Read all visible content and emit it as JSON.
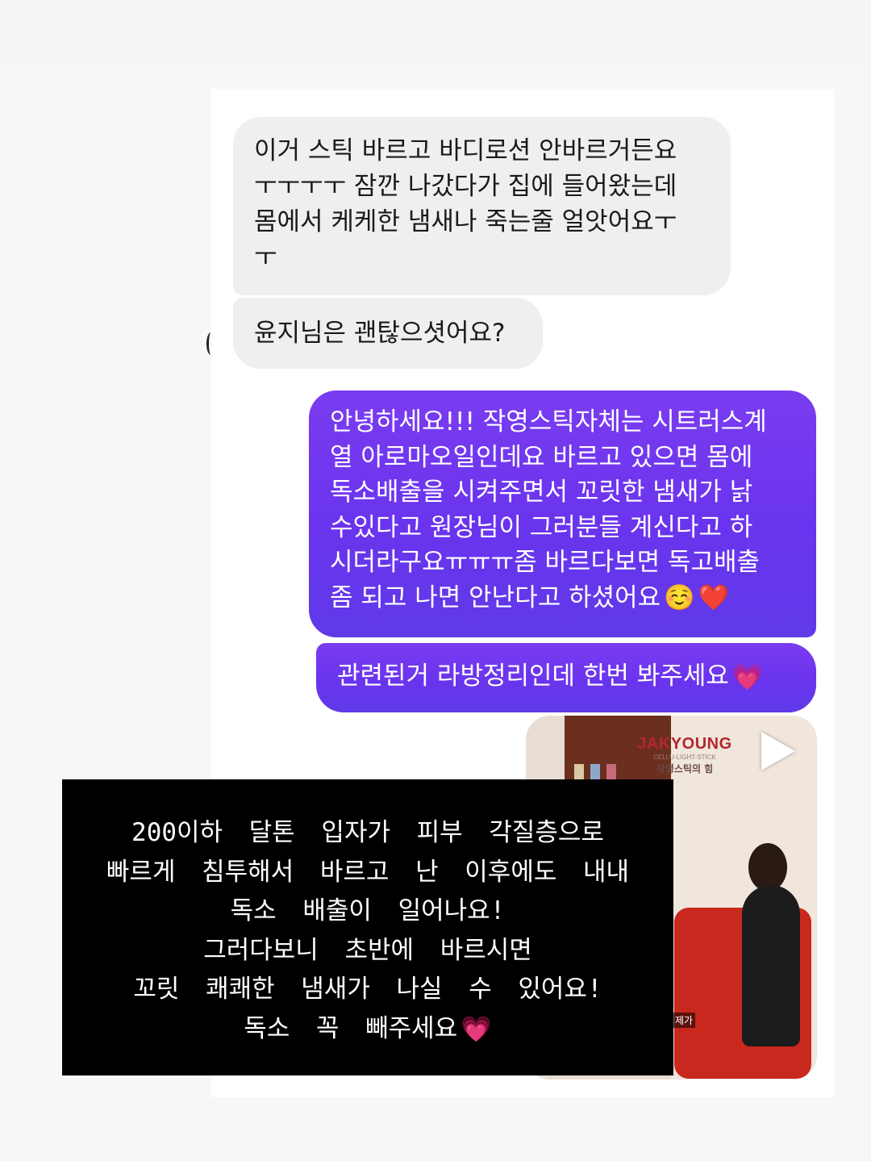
{
  "messages": [
    {
      "direction": "in",
      "lines": [
        "이거 스틱 바르고 바디로션 안바르거든요",
        "ㅜㅜㅜㅜ 잠깐 나갔다가 집에 들어왔는데",
        "몸에서 케케한 냄새나 죽는줄 얼앗어요ㅜ",
        "ㅜ"
      ]
    },
    {
      "direction": "in",
      "lines": [
        "윤지님은 괜탆으셧어요?"
      ]
    },
    {
      "direction": "out",
      "lines": [
        "안녕하세요!!! 작영스틱자체는 시트러스계",
        "열 아로마오일인데요 바르고 있으면 몸에",
        "독소배출을 시켜주면서 꼬릿한 냄새가 낡",
        "수있다고 원장님이 그러분들 계신다고 하",
        "시더라구요ㅠㅠㅠ좀 바르다보면 독고배출",
        "좀 되고 나면 안난다고 하셨어요"
      ],
      "emojis": [
        "☺️",
        "❤️"
      ]
    },
    {
      "direction": "out",
      "lines": [
        "관련된거 라방정리인데 한번 봐주세요"
      ],
      "emojis": [
        "💗"
      ]
    }
  ],
  "video": {
    "brand": "JAKYOUNG",
    "subtitle": "CELLU-LIGHT-STICK",
    "subtitle2": "작영스틱의 힘",
    "caption": "제가",
    "play_icon": "play-icon"
  },
  "overlay": {
    "lines": [
      "200이하 달톤 입자가 피부 각질층으로",
      "빠르게 침투해서 바르고 난 이후에도 내내",
      "독소 배출이 일어나요!",
      "그러다보니 초반에 바르시면",
      "꼬릿 쾌쾌한 냄새가 나실 수 있어요!",
      "독소 꼭 빼주세요"
    ],
    "emoji": "💗"
  },
  "colors": {
    "incoming_bubble": "#efefef",
    "outgoing_bubble": "#6a34ee",
    "overlay_bg": "#000000"
  }
}
